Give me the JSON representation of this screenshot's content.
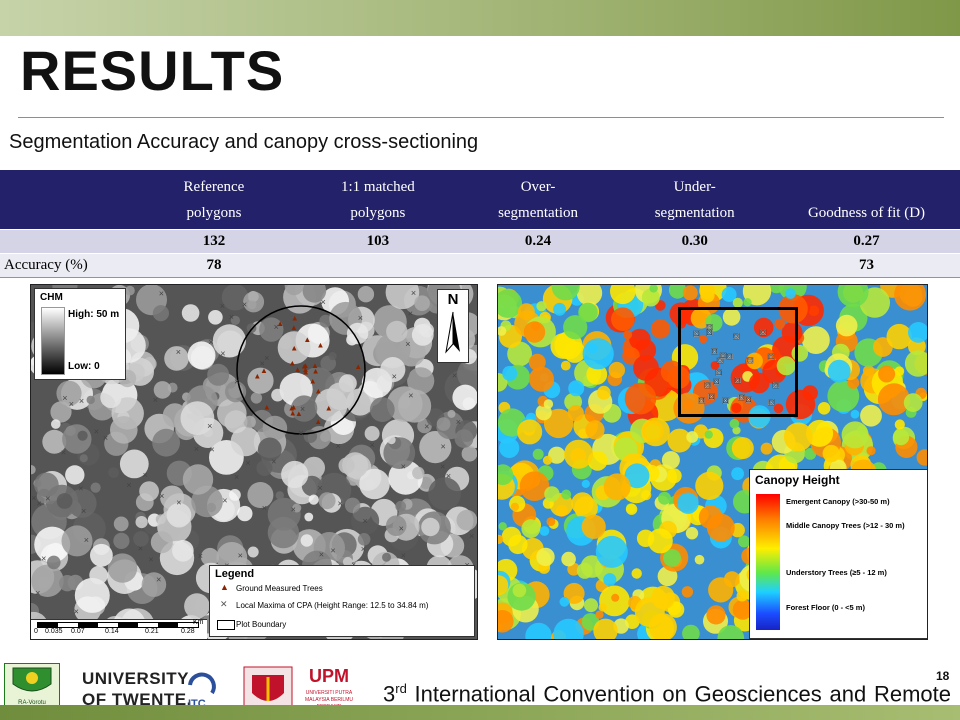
{
  "slide": {
    "title": "RESULTS",
    "subtitle": "Segmentation Accuracy and canopy cross-sectioning",
    "page_number": "18",
    "conference_prefix": "3",
    "conference_sup": "rd",
    "conference_text": " International Convention on Geosciences and Remote Sensing"
  },
  "table": {
    "headers": [
      "",
      "Reference polygons",
      "1:1 matched polygons",
      "Over-segmentation",
      "Under-segmentation",
      "Goodness of fit (D)"
    ],
    "header_lines": [
      [
        "",
        ""
      ],
      [
        "Reference",
        "polygons"
      ],
      [
        "1:1 matched",
        "polygons"
      ],
      [
        "Over-",
        "segmentation"
      ],
      [
        "Under-",
        "segmentation"
      ],
      [
        "",
        "Goodness of fit (D)"
      ]
    ],
    "rows": [
      [
        "",
        "132",
        "103",
        "0.24",
        "0.30",
        "0.27"
      ],
      [
        "Accuracy (%)",
        "78",
        "",
        "",
        "",
        "73"
      ]
    ]
  },
  "chm_map": {
    "legend_title": "CHM",
    "high_label": "High: 50 m",
    "low_label": "Low: 0",
    "north_label": "N",
    "map_legend_title": "Legend",
    "legend_items": [
      "Ground Measured Trees",
      "Local Maxima of CPA (Height Range: 12.5 to 34.84 m)",
      "Plot Boundary"
    ],
    "scale_ticks": [
      "0",
      "0.035",
      "0.07",
      "0.14",
      "0.21",
      "0.28"
    ],
    "scale_unit": "Km"
  },
  "canopy_map": {
    "legend_title": "Canopy Height",
    "classes": [
      "Emergent Canopy (>30-50 m)",
      "Middle Canopy Trees (>12 - 30 m)",
      "Understory Trees (≥5 - 12 m)",
      "Forest Floor (0 - <5 m)"
    ]
  },
  "logos": {
    "ra": "RA-Vorotu Unviersity Bahir Dar",
    "twente_line1": "UNIVERSITY",
    "twente_line2": "OF TWENTE.",
    "itc": "ITC",
    "upm": "UPM",
    "upm_sub": "UNIVERSITI PUTRA MALAYSIA BERILMU BERBAKTI"
  },
  "colors": {
    "table_header": "#23216a",
    "row1": "#d4d4e6",
    "row2": "#ebebf3",
    "accent_green": "#8ea55c"
  }
}
